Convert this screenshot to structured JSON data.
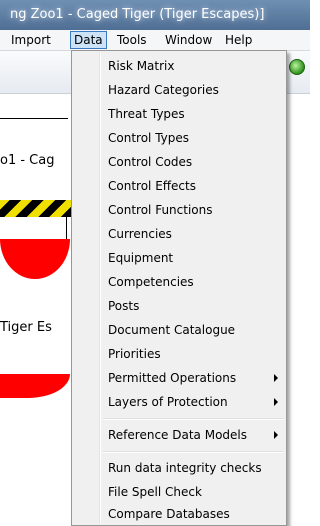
{
  "window": {
    "title": "ng Zoo1 - Caged Tiger (Tiger Escapes)]"
  },
  "menubar": {
    "items": [
      {
        "label": "Import"
      },
      {
        "label": "Data"
      },
      {
        "label": "Tools"
      },
      {
        "label": "Window"
      },
      {
        "label": "Help"
      }
    ]
  },
  "background": {
    "text1": "o1 - Cag",
    "text2": "Tiger Es"
  },
  "data_menu": {
    "items": [
      {
        "label": "Risk Matrix"
      },
      {
        "label": "Hazard Categories"
      },
      {
        "label": "Threat Types"
      },
      {
        "label": "Control Types"
      },
      {
        "label": "Control Codes"
      },
      {
        "label": "Control Effects"
      },
      {
        "label": "Control Functions"
      },
      {
        "label": "Currencies"
      },
      {
        "label": "Equipment"
      },
      {
        "label": "Competencies"
      },
      {
        "label": "Posts"
      },
      {
        "label": "Document Catalogue"
      },
      {
        "label": "Priorities"
      },
      {
        "label": "Permitted Operations",
        "submenu": true
      },
      {
        "label": "Layers of Protection",
        "submenu": true
      },
      {
        "label": "Reference Data Models",
        "submenu": true
      },
      {
        "label": "Run data integrity checks"
      },
      {
        "label": "File Spell Check"
      },
      {
        "label": "Compare Databases"
      }
    ]
  },
  "colors": {
    "menu_highlight": "#cde3f8",
    "menu_highlight_border": "#3b79c1",
    "hazard_yellow": "#f0e000",
    "shape_red": "#ff0000"
  }
}
